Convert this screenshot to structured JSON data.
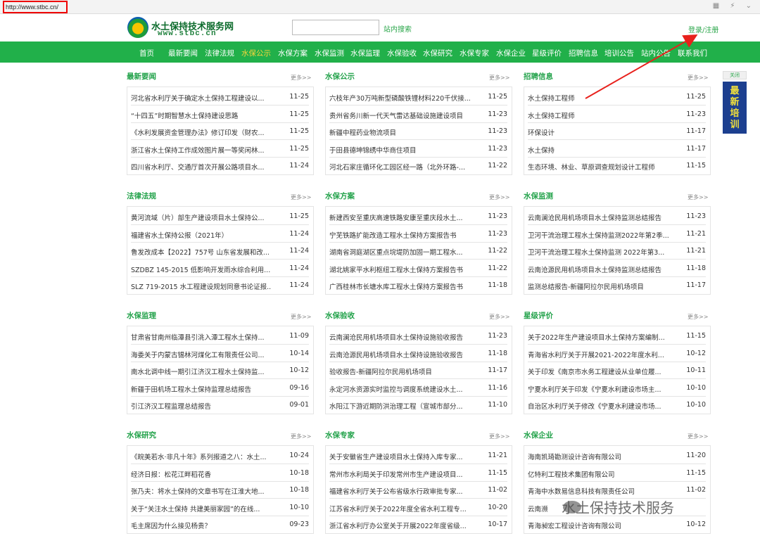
{
  "browser": {
    "url": "http://www.stbc.cn/"
  },
  "header": {
    "title": "水土保持技术服务网",
    "subtitle": "www.stbc.cn",
    "search_placeholder": "",
    "search_button": "站内搜索",
    "login": "登录/注册"
  },
  "nav": [
    {
      "label": "首页"
    },
    {
      "label": "最新要闻"
    },
    {
      "label": "法律法规"
    },
    {
      "label": "水保公示",
      "active": true
    },
    {
      "label": "水保方案"
    },
    {
      "label": "水保监测"
    },
    {
      "label": "水保监理"
    },
    {
      "label": "水保验收"
    },
    {
      "label": "水保研究"
    },
    {
      "label": "水保专家"
    },
    {
      "label": "水保企业"
    },
    {
      "label": "星级评价"
    },
    {
      "label": "招聘信息"
    },
    {
      "label": "培训公告"
    },
    {
      "label": "站内公告"
    },
    {
      "label": "联系我们"
    }
  ],
  "more_label": "更多>>",
  "sections": [
    {
      "title": "最新要闻",
      "items": [
        {
          "title": "河北省水利厅关于确定水土保持工程建设以...",
          "date": "11-25"
        },
        {
          "title": "“十四五”时期智慧水土保持建设思路",
          "date": "11-25"
        },
        {
          "title": "《水利发展资金管理办法》修订印发（财农...",
          "date": "11-25"
        },
        {
          "title": "浙江省水土保持工作成效图片展一等奖闲林...",
          "date": "11-25"
        },
        {
          "title": "四川省水利厅、交通厅首次开展公路项目水...",
          "date": "11-24"
        }
      ]
    },
    {
      "title": "水保公示",
      "items": [
        {
          "title": "六枝年产30万吨新型磷酸铁锂材料220千伏接...",
          "date": "11-25"
        },
        {
          "title": "贵州省务川新一代天气雷达基础设施建设项目",
          "date": "11-23"
        },
        {
          "title": "新疆中程药业物流项目",
          "date": "11-23"
        },
        {
          "title": "于田县德坤锦绣中华商住项目",
          "date": "11-23"
        },
        {
          "title": "河北石家庄循环化工园区经一路（北外环路-...",
          "date": "11-22"
        }
      ]
    },
    {
      "title": "招聘信息",
      "items": [
        {
          "title": "水土保持工程师",
          "date": "11-25"
        },
        {
          "title": "水土保持工程师",
          "date": "11-23"
        },
        {
          "title": "环保设计",
          "date": "11-17"
        },
        {
          "title": "水土保持",
          "date": "11-17"
        },
        {
          "title": "生态环境、林业、草原调查规划设计工程师",
          "date": "11-15"
        }
      ]
    },
    {
      "title": "法律法规",
      "items": [
        {
          "title": "黄河流域（片）部生产建设项目水土保持公...",
          "date": "11-25"
        },
        {
          "title": "福建省水土保持公报（2021年）",
          "date": "11-24"
        },
        {
          "title": "鲁发改成本【2022】757号 山东省发展和改...",
          "date": "11-24"
        },
        {
          "title": "SZDBZ 145-2015 低影响开发雨水综合利用...",
          "date": "11-24"
        },
        {
          "title": "SLZ 719-2015 水工程建设规划同意书论证报...",
          "date": "11-24"
        }
      ]
    },
    {
      "title": "水保方案",
      "items": [
        {
          "title": "新建西安至重庆高速铁路安康至重庆段水土...",
          "date": "11-23"
        },
        {
          "title": "宁芜铁路扩能改造工程水土保持方案报告书",
          "date": "11-23"
        },
        {
          "title": "湖南省洞庭湖区重点垸堤防加固一期工程水...",
          "date": "11-22"
        },
        {
          "title": "湖北姚家平水利枢纽工程水土保持方案报告书",
          "date": "11-22"
        },
        {
          "title": "广西桂林市长塘水库工程水土保持方案报告书",
          "date": "11-18"
        }
      ]
    },
    {
      "title": "水保监测",
      "items": [
        {
          "title": "云南澜沧民用机场项目水土保持监测总结报告",
          "date": "11-23"
        },
        {
          "title": "卫河干流治理工程水土保持监测2022年第2季...",
          "date": "11-21"
        },
        {
          "title": "卫河干流治理工程水土保持监测 2022年第3...",
          "date": "11-21"
        },
        {
          "title": "云南沧源民用机场项目水土保持监测总结报告",
          "date": "11-18"
        },
        {
          "title": "监测总结报告-新疆阿拉尔民用机场项目",
          "date": "11-17"
        }
      ]
    },
    {
      "title": "水保监理",
      "items": [
        {
          "title": "甘肃省甘南州临潭县引洮入潭工程水土保持...",
          "date": "11-09"
        },
        {
          "title": "海委关于内蒙古锡林河煤化工有限责任公司...",
          "date": "10-14"
        },
        {
          "title": "南水北调中线一期引江济汉工程水土保持监...",
          "date": "10-12"
        },
        {
          "title": "新疆于田机场工程水土保持监理总结报告",
          "date": "09-16"
        },
        {
          "title": "引江济汉工程监理总结报告",
          "date": "09-01"
        }
      ]
    },
    {
      "title": "水保验收",
      "items": [
        {
          "title": "云南澜沧民用机场项目水土保持设施验收报告",
          "date": "11-23"
        },
        {
          "title": "云南沧源民用机场项目水土保持设施验收报告",
          "date": "11-18"
        },
        {
          "title": "验收报告-新疆阿拉尔民用机场项目",
          "date": "11-17"
        },
        {
          "title": "永定河水资源实时监控与调度系统建设水土...",
          "date": "11-16"
        },
        {
          "title": "水阳江下游近期防洪治理工程（宣城市部分...",
          "date": "11-10"
        }
      ]
    },
    {
      "title": "星级评价",
      "items": [
        {
          "title": "关于2022年生产建设项目水土保持方案编制...",
          "date": "11-15"
        },
        {
          "title": "青海省水利厅关于开展2021-2022年度水利...",
          "date": "10-12"
        },
        {
          "title": "关于印发《南京市水务工程建设从业单位履...",
          "date": "10-11"
        },
        {
          "title": "宁夏水利厅关于印发《宁夏水利建设市场主...",
          "date": "10-10"
        },
        {
          "title": "自治区水利厅关于修改《宁夏水利建设市场...",
          "date": "10-10"
        }
      ]
    },
    {
      "title": "水保研究",
      "items": [
        {
          "title": "《皖美若水·非凡十年》系列报道之八：水土...",
          "date": "10-24"
        },
        {
          "title": "经济日报：松花江畔稻花香",
          "date": "10-18"
        },
        {
          "title": "张乃夫：将水土保持的文章书写在江淮大地...",
          "date": "10-18"
        },
        {
          "title": "关于“关注水土保持 共建美丽家园”的在线...",
          "date": "10-10"
        },
        {
          "title": "毛主席因为什么接见杨贵？",
          "date": "09-23"
        }
      ]
    },
    {
      "title": "水保专家",
      "items": [
        {
          "title": "关于安徽省生产建设项目水土保持入库专家...",
          "date": "11-21"
        },
        {
          "title": "常州市水利局关于印发常州市生产建设项目...",
          "date": "11-15"
        },
        {
          "title": "福建省水利厅关于公布省级水行政审批专家...",
          "date": "11-02"
        },
        {
          "title": "江苏省水利厅关于2022年度全省水利工程专...",
          "date": "10-20"
        },
        {
          "title": "浙江省水利厅办公室关于开展2022年度省级...",
          "date": "10-17"
        }
      ]
    },
    {
      "title": "水保企业",
      "items": [
        {
          "title": "海南凯琦勘测设计咨询有限公司",
          "date": "11-20"
        },
        {
          "title": "亿特利工程技术集团有限公司",
          "date": "11-15"
        },
        {
          "title": "青海中水数易信息科技有限责任公司",
          "date": "11-02"
        },
        {
          "title": "云南濒",
          "date": ""
        },
        {
          "title": "青海昶宏工程设计咨询有限公司",
          "date": "10-12"
        }
      ]
    }
  ],
  "side_ad": {
    "close": "关闭",
    "text": "最新培训"
  },
  "watermark": "水土保持技术服务",
  "annotation_color": "#e8211c"
}
